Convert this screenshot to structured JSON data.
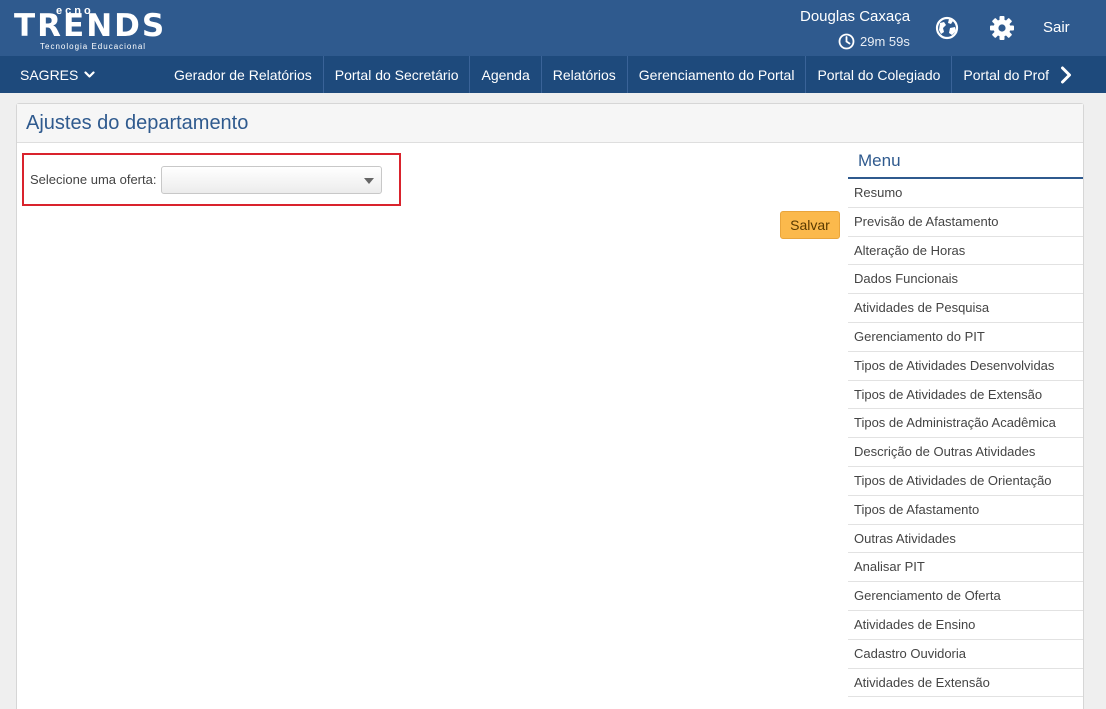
{
  "header": {
    "logo": {
      "main": "TRENDS",
      "top": "ecno",
      "sub": "Tecnologia Educacional"
    },
    "user_name": "Douglas Caxaça",
    "session_timer": "29m 59s",
    "logout_label": "Sair",
    "icons": {
      "timer": "clock-icon",
      "globe": "globe-icon",
      "settings": "gear-icon"
    }
  },
  "nav": {
    "sagres_label": "SAGRES",
    "items": [
      {
        "label": "Gerador de Relatórios"
      },
      {
        "label": "Portal do Secretário"
      },
      {
        "label": "Agenda"
      },
      {
        "label": "Relatórios"
      },
      {
        "label": "Gerenciamento do Portal"
      },
      {
        "label": "Portal do Colegiado"
      },
      {
        "label": "Portal do Prof"
      }
    ]
  },
  "page": {
    "title": "Ajustes do departamento",
    "offer_label": "Selecione uma oferta:",
    "offer_selected": "",
    "save_label": "Salvar"
  },
  "menu": {
    "title": "Menu",
    "items": [
      {
        "label": "Resumo"
      },
      {
        "label": "Previsão de Afastamento"
      },
      {
        "label": "Alteração de Horas"
      },
      {
        "label": "Dados Funcionais"
      },
      {
        "label": "Atividades de Pesquisa"
      },
      {
        "label": "Gerenciamento do PIT"
      },
      {
        "label": "Tipos de Atividades Desenvolvidas"
      },
      {
        "label": "Tipos de Atividades de Extensão"
      },
      {
        "label": "Tipos de Administração Acadêmica"
      },
      {
        "label": "Descrição de Outras Atividades"
      },
      {
        "label": "Tipos de Atividades de Orientação"
      },
      {
        "label": "Tipos de Afastamento"
      },
      {
        "label": "Outras Atividades"
      },
      {
        "label": "Analisar PIT"
      },
      {
        "label": "Gerenciamento de Oferta"
      },
      {
        "label": "Atividades de Ensino"
      },
      {
        "label": "Cadastro Ouvidoria"
      },
      {
        "label": "Atividades de Extensão"
      }
    ]
  },
  "colors": {
    "header_bg": "#2f5a8e",
    "nav_bg": "#1e4a7c",
    "accent_title": "#2f5a8e",
    "save_button": "#fbb94c",
    "highlight_border": "#d9232d"
  }
}
